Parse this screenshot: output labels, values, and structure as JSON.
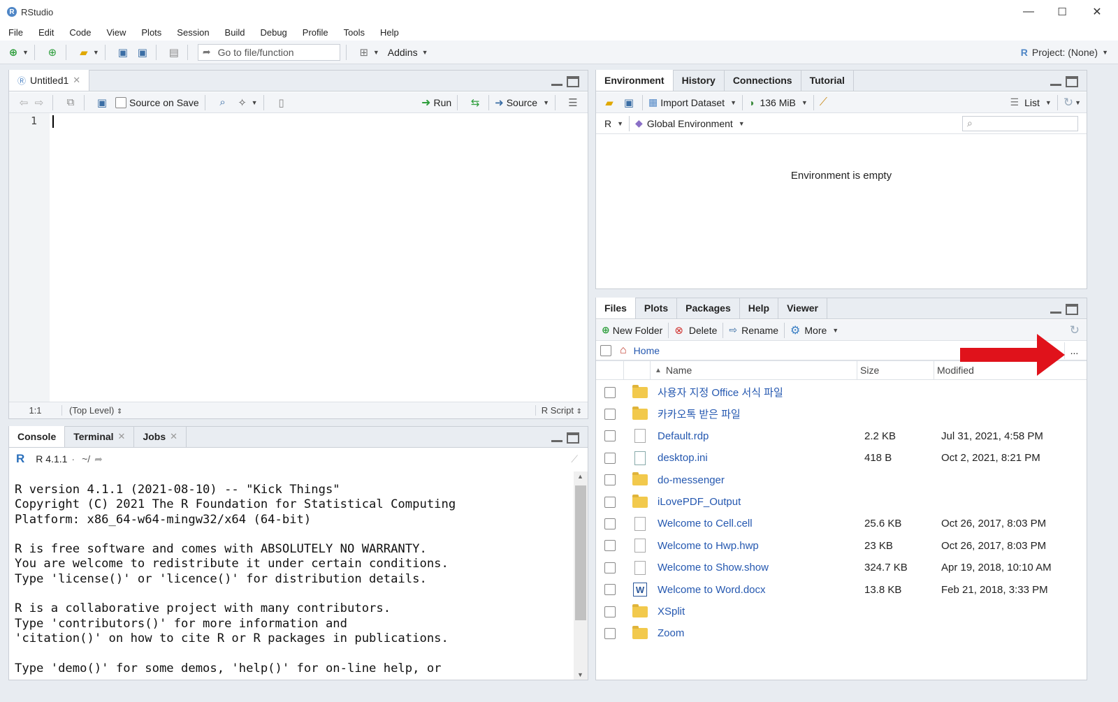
{
  "window": {
    "title": "RStudio",
    "minimize": "—",
    "maximize": "☐",
    "close": "✕"
  },
  "menu": [
    "File",
    "Edit",
    "Code",
    "View",
    "Plots",
    "Session",
    "Build",
    "Debug",
    "Profile",
    "Tools",
    "Help"
  ],
  "main_toolbar": {
    "goto_placeholder": "Go to file/function",
    "addins": "Addins",
    "project": "Project: (None)"
  },
  "editor": {
    "tab": "Untitled1",
    "source_on_save": "Source on Save",
    "run": "Run",
    "source": "Source",
    "line_number": "1",
    "status_position": "1:1",
    "status_scope": "(Top Level)",
    "status_type": "R Script"
  },
  "console": {
    "tabs": [
      "Console",
      "Terminal",
      "Jobs"
    ],
    "r_version": "R 4.1.1",
    "path": "~/",
    "text": "R version 4.1.1 (2021-08-10) -- \"Kick Things\"\nCopyright (C) 2021 The R Foundation for Statistical Computing\nPlatform: x86_64-w64-mingw32/x64 (64-bit)\n\nR is free software and comes with ABSOLUTELY NO WARRANTY.\nYou are welcome to redistribute it under certain conditions.\nType 'license()' or 'licence()' for distribution details.\n\nR is a collaborative project with many contributors.\nType 'contributors()' for more information and\n'citation()' on how to cite R or R packages in publications.\n\nType 'demo()' for some demos, 'help()' for on-line help, or"
  },
  "environment": {
    "tabs": [
      "Environment",
      "History",
      "Connections",
      "Tutorial"
    ],
    "import_dataset": "Import Dataset",
    "memory": "136 MiB",
    "list_view": "List",
    "language": "R",
    "scope": "Global Environment",
    "empty_message": "Environment is empty"
  },
  "files": {
    "tabs": [
      "Files",
      "Plots",
      "Packages",
      "Help",
      "Viewer"
    ],
    "new_folder": "New Folder",
    "delete": "Delete",
    "rename": "Rename",
    "more": "More",
    "breadcrumb": "Home",
    "ellipsis": "...",
    "columns": {
      "name": "Name",
      "size": "Size",
      "modified": "Modified"
    },
    "rows": [
      {
        "icon": "folder-icon",
        "name": "사용자 지정 Office 서식 파일",
        "size": "",
        "modified": ""
      },
      {
        "icon": "folder-icon",
        "name": "카카오톡 받은 파일",
        "size": "",
        "modified": ""
      },
      {
        "icon": "file-icon",
        "name": "Default.rdp",
        "size": "2.2 KB",
        "modified": "Jul 31, 2021, 4:58 PM"
      },
      {
        "icon": "settings-file-icon",
        "name": "desktop.ini",
        "size": "418 B",
        "modified": "Oct 2, 2021, 8:21 PM"
      },
      {
        "icon": "folder-icon",
        "name": "do-messenger",
        "size": "",
        "modified": ""
      },
      {
        "icon": "folder-icon",
        "name": "iLovePDF_Output",
        "size": "",
        "modified": ""
      },
      {
        "icon": "file-icon",
        "name": "Welcome to Cell.cell",
        "size": "25.6 KB",
        "modified": "Oct 26, 2017, 8:03 PM"
      },
      {
        "icon": "file-icon",
        "name": "Welcome to Hwp.hwp",
        "size": "23 KB",
        "modified": "Oct 26, 2017, 8:03 PM"
      },
      {
        "icon": "file-icon",
        "name": "Welcome to Show.show",
        "size": "324.7 KB",
        "modified": "Apr 19, 2018, 10:10 AM"
      },
      {
        "icon": "word-icon",
        "name": "Welcome to Word.docx",
        "size": "13.8 KB",
        "modified": "Feb 21, 2018, 3:33 PM"
      },
      {
        "icon": "folder-icon",
        "name": "XSplit",
        "size": "",
        "modified": ""
      },
      {
        "icon": "folder-icon",
        "name": "Zoom",
        "size": "",
        "modified": ""
      }
    ]
  },
  "colors": {
    "annotation_arrow": "#e0121b",
    "link": "#2558b0",
    "accent": "#4f86c6"
  }
}
